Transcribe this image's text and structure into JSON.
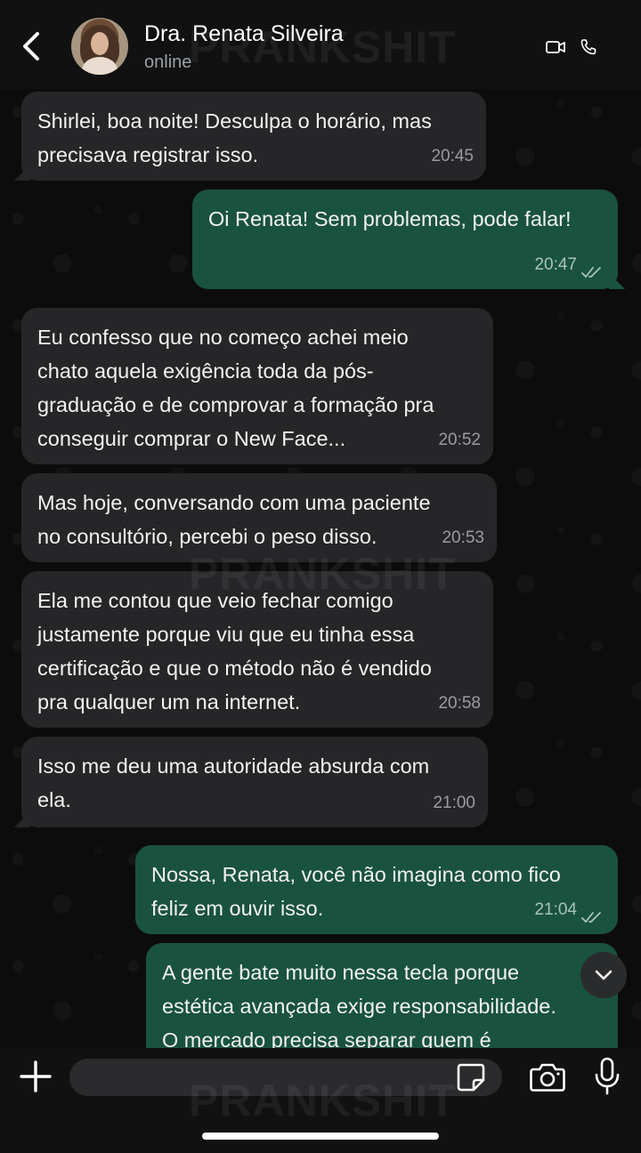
{
  "header": {
    "contact_name": "Dra. Renata Silveira",
    "status": "online",
    "icons": [
      "back-arrow-icon",
      "avatar",
      "video-call-icon",
      "phone-icon"
    ]
  },
  "watermark": "PRANKSHIT",
  "messages": [
    {
      "direction": "in",
      "text": "Shirlei, boa noite! Desculpa o horário, mas\nprecisava registrar isso.",
      "time": "20:45"
    },
    {
      "direction": "out",
      "text": "Oi Renata! Sem problemas, pode falar!",
      "time": "20:47",
      "read": true
    },
    {
      "direction": "in",
      "text": "Eu confesso que no começo achei meio\nchato aquela exigência toda da pós-\ngraduação e de comprovar a formação pra\nconseguir comprar o New Face...",
      "time": "20:52"
    },
    {
      "direction": "in",
      "text": "Mas hoje, conversando com uma paciente\nno consultório, percebi o peso disso.",
      "time": "20:53"
    },
    {
      "direction": "in",
      "text": "Ela me contou que veio fechar comigo\njustamente porque viu que eu tinha essa\ncertificação e que o método não é vendido\npra qualquer um na internet.",
      "time": "20:58"
    },
    {
      "direction": "in",
      "text": "Isso me deu uma autoridade absurda com\nela.",
      "time": "21:00"
    },
    {
      "direction": "out",
      "text": "Nossa, Renata, você não imagina como fico\nfeliz em ouvir isso.",
      "time": "21:04",
      "read": true
    },
    {
      "direction": "out",
      "text": "A gente bate muito nessa tecla porque\nestética avançada exige responsabilidade.\nO mercado precisa separar quem é",
      "time": ""
    }
  ],
  "composer": {
    "placeholder": "",
    "icons": [
      "plus-icon",
      "sticker-icon",
      "camera-icon",
      "microphone-icon"
    ]
  },
  "colors": {
    "incoming_bubble": "#262628",
    "outgoing_bubble": "#1a5240",
    "background": "#0c0c0c",
    "timestamp": "#9b9ba0"
  }
}
